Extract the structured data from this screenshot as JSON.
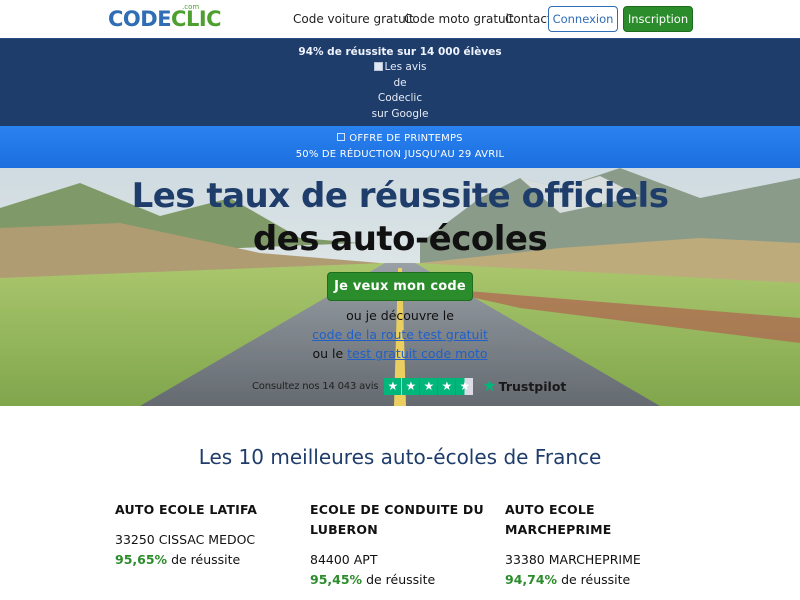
{
  "nav": {
    "logo_part1": "CO",
    "logo_part2": "DE",
    "logo_part3": "CLIC",
    "logo_suffix": ".com",
    "links": [
      "Code voiture gratuit",
      "Code moto gratuit",
      "Contact"
    ],
    "login_label": "Connexion",
    "signup_label": "Inscription"
  },
  "banner": {
    "success_text": "94% de réussite sur 14 000 élèves",
    "google_alt_lines": [
      "Les avis",
      "de",
      "Codeclic",
      "sur Google"
    ]
  },
  "promo": {
    "line1": "OFFRE DE PRINTEMPS",
    "line2": "50% DE RÉDUCTION JUSQU'AU 29 AVRIL"
  },
  "hero": {
    "title_line1": "Les taux de réussite officiels",
    "title_line2": "des auto-écoles",
    "cta_label": "Je veux mon code",
    "discover_text": "ou je découvre le",
    "car_test_link": "code de la route test gratuit",
    "or_text": "ou le",
    "moto_test_link": "test gratuit code moto",
    "trust_text": "Consultez nos 14 043 avis",
    "trustpilot_label": "Trustpilot",
    "rating_stars": 4.5
  },
  "best": {
    "title": "Les 10 meilleures auto-écoles de France",
    "rate_suffix": "de réussite",
    "schools": [
      {
        "name": "AUTO ECOLE LATIFA",
        "city": "33250 CISSAC MEDOC",
        "rate": "95,65%"
      },
      {
        "name": "ECOLE DE CONDUITE DU LUBERON",
        "city": "84400 APT",
        "rate": "95,45%"
      },
      {
        "name": "AUTO ECOLE MARCHEPRIME",
        "city": "33380 MARCHEPRIME",
        "rate": "94,74%"
      }
    ]
  },
  "colors": {
    "brand_blue": "#1f3d6b",
    "link_blue": "#2060c8",
    "brand_green": "#2b8c2b",
    "promo_blue": "#2278e8",
    "trustpilot_green": "#00b67a"
  }
}
